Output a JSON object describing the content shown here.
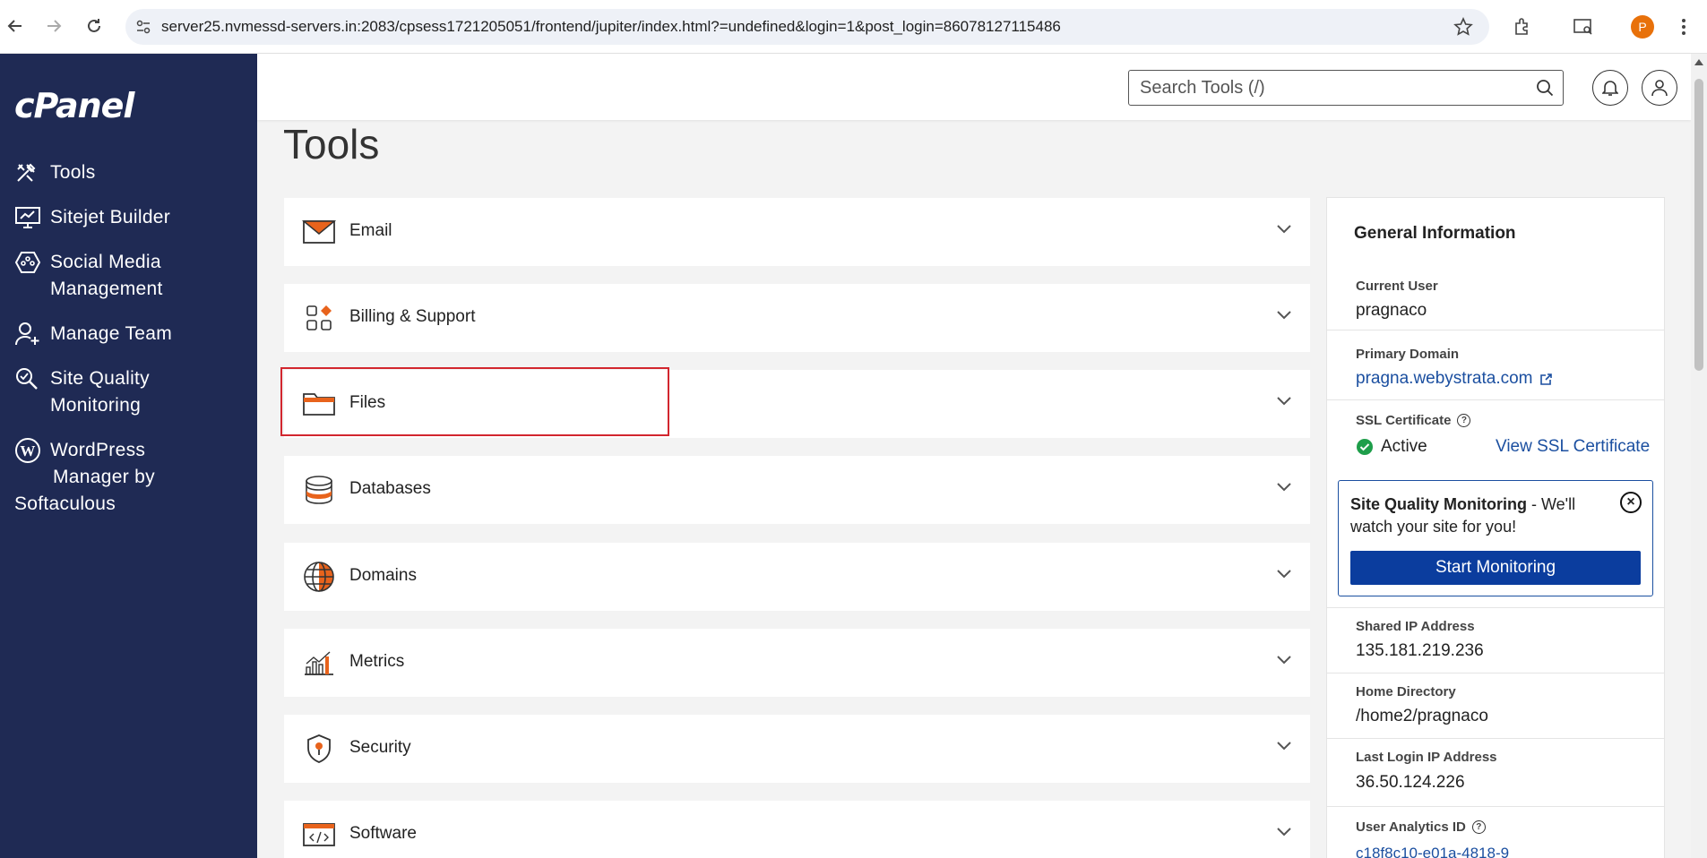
{
  "browser": {
    "url": "server25.nvmessd-servers.in:2083/cpsess1721205051/frontend/jupiter/index.html?=undefined&login=1&post_login=86078127115486",
    "profile_initial": "P"
  },
  "sidebar": {
    "logo": "cPanel",
    "items": [
      {
        "label": "Tools",
        "icon": "tools-icon"
      },
      {
        "label": "Sitejet Builder",
        "icon": "monitor-icon"
      },
      {
        "label": "Social Media Management",
        "line1": "Social Media",
        "line2": "Management",
        "icon": "social-icon"
      },
      {
        "label": "Manage Team",
        "icon": "user-plus-icon"
      },
      {
        "label": "Site Quality Monitoring",
        "line1": "Site Quality",
        "line2": "Monitoring",
        "icon": "magnifier-icon"
      },
      {
        "label": "WordPress Manager by Softaculous",
        "line1": "WordPress",
        "line2": "Manager by",
        "line3": "Softaculous",
        "icon": "wordpress-icon"
      }
    ]
  },
  "header": {
    "search_placeholder": "Search Tools (/)"
  },
  "main": {
    "title": "Tools",
    "sections": [
      {
        "label": "Email"
      },
      {
        "label": "Billing & Support"
      },
      {
        "label": "Files"
      },
      {
        "label": "Databases"
      },
      {
        "label": "Domains"
      },
      {
        "label": "Metrics"
      },
      {
        "label": "Security"
      },
      {
        "label": "Software"
      }
    ]
  },
  "info": {
    "title": "General Information",
    "current_user_label": "Current User",
    "current_user": "pragnaco",
    "primary_domain_label": "Primary Domain",
    "primary_domain": "pragna.webystrata.com",
    "ssl_label": "SSL Certificate",
    "ssl_status": "Active",
    "ssl_link": "View SSL Certificate",
    "sqm_title": "Site Quality Monitoring",
    "sqm_text": " - We'll watch your site for you!",
    "sqm_button": "Start Monitoring",
    "shared_ip_label": "Shared IP Address",
    "shared_ip": "135.181.219.236",
    "home_dir_label": "Home Directory",
    "home_dir": "/home2/pragnaco",
    "last_login_label": "Last Login IP Address",
    "last_login": "36.50.124.226",
    "analytics_label": "User Analytics ID",
    "analytics_id": "c18f8c10-e01a-4818-9"
  },
  "colors": {
    "sidebar_bg": "#1f2a54",
    "accent_orange": "#e8631c",
    "link_blue": "#1b4fa0",
    "button_blue": "#0b3d9e",
    "highlight_red": "#d2262e",
    "ssl_green": "#1e9e4a"
  }
}
